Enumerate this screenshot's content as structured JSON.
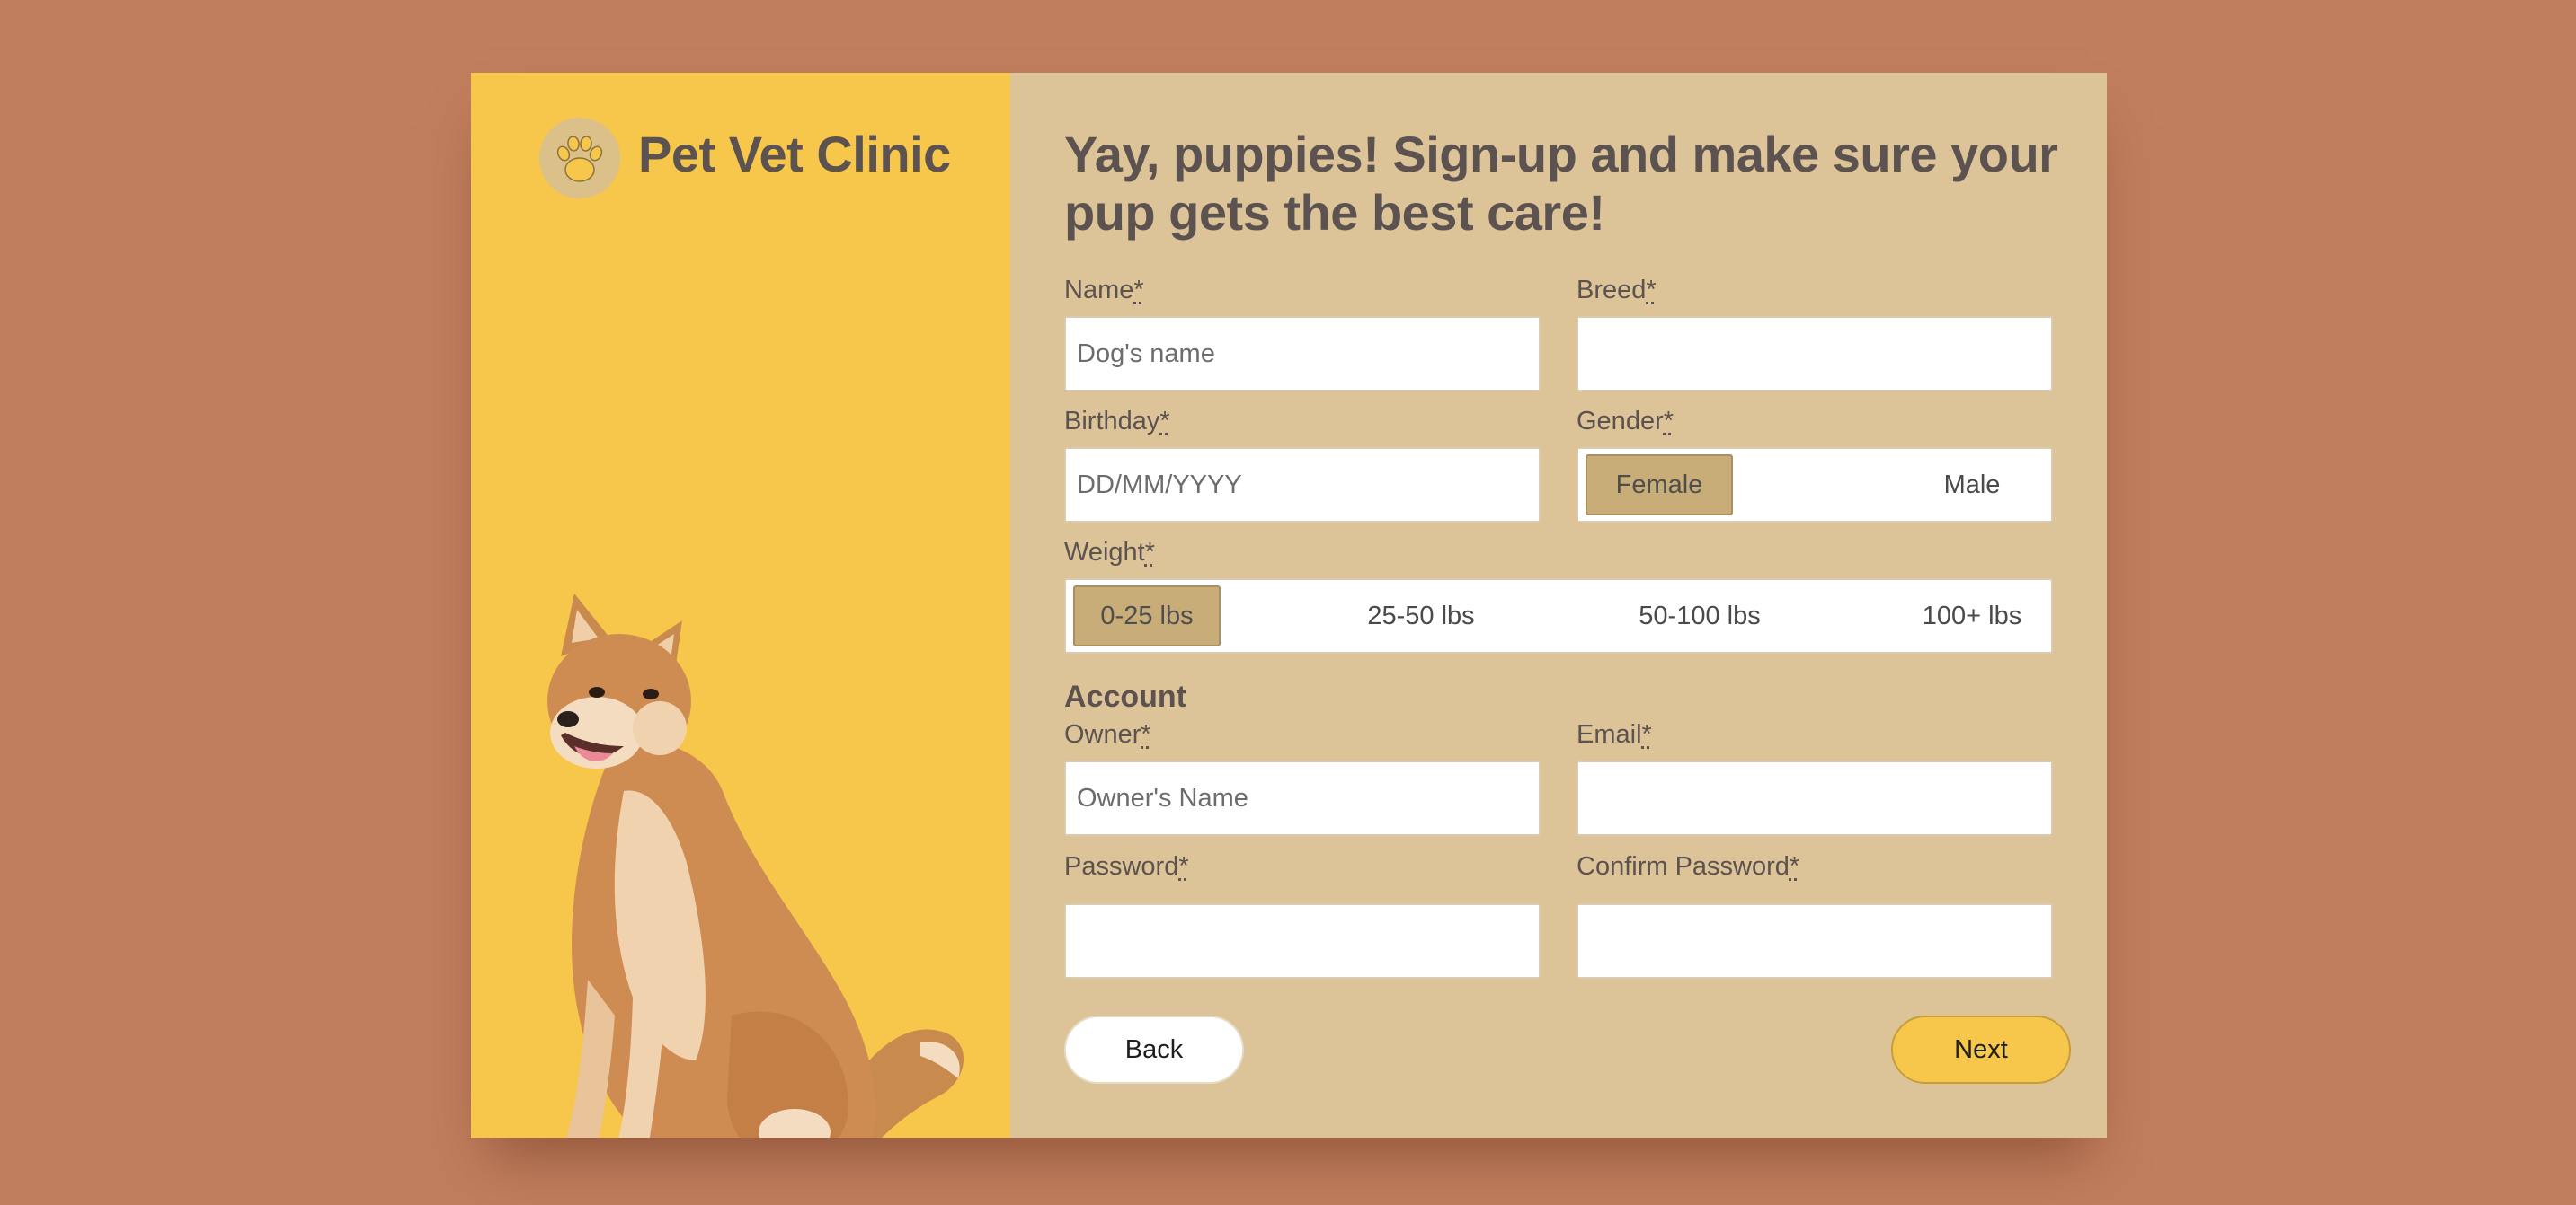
{
  "brand": {
    "name": "Pet Vet Clinic",
    "logo_icon": "paw-icon",
    "accent": "#f6c74a",
    "panel": "#dcc498",
    "background": "#c17e5e"
  },
  "headline": "Yay, puppies! Sign-up and make sure your pup gets the best care!",
  "required_marker": "*",
  "pet": {
    "name": {
      "label": "Name",
      "placeholder": "Dog's name",
      "value": ""
    },
    "breed": {
      "label": "Breed",
      "placeholder": "",
      "value": ""
    },
    "birthday": {
      "label": "Birthday",
      "placeholder": "DD/MM/YYYY",
      "value": ""
    },
    "gender": {
      "label": "Gender",
      "options": [
        "Female",
        "Male"
      ],
      "selected": "Female"
    },
    "weight": {
      "label": "Weight",
      "options": [
        "0-25 lbs",
        "25-50 lbs",
        "50-100 lbs",
        "100+ lbs"
      ],
      "selected": "0-25 lbs"
    }
  },
  "account": {
    "heading": "Account",
    "owner": {
      "label": "Owner",
      "placeholder": "Owner's Name",
      "value": ""
    },
    "email": {
      "label": "Email",
      "placeholder": "",
      "value": ""
    },
    "password": {
      "label": "Password",
      "placeholder": "",
      "value": ""
    },
    "confirm_password": {
      "label": "Confirm Password",
      "placeholder": "",
      "value": ""
    }
  },
  "actions": {
    "back": "Back",
    "next": "Next"
  }
}
